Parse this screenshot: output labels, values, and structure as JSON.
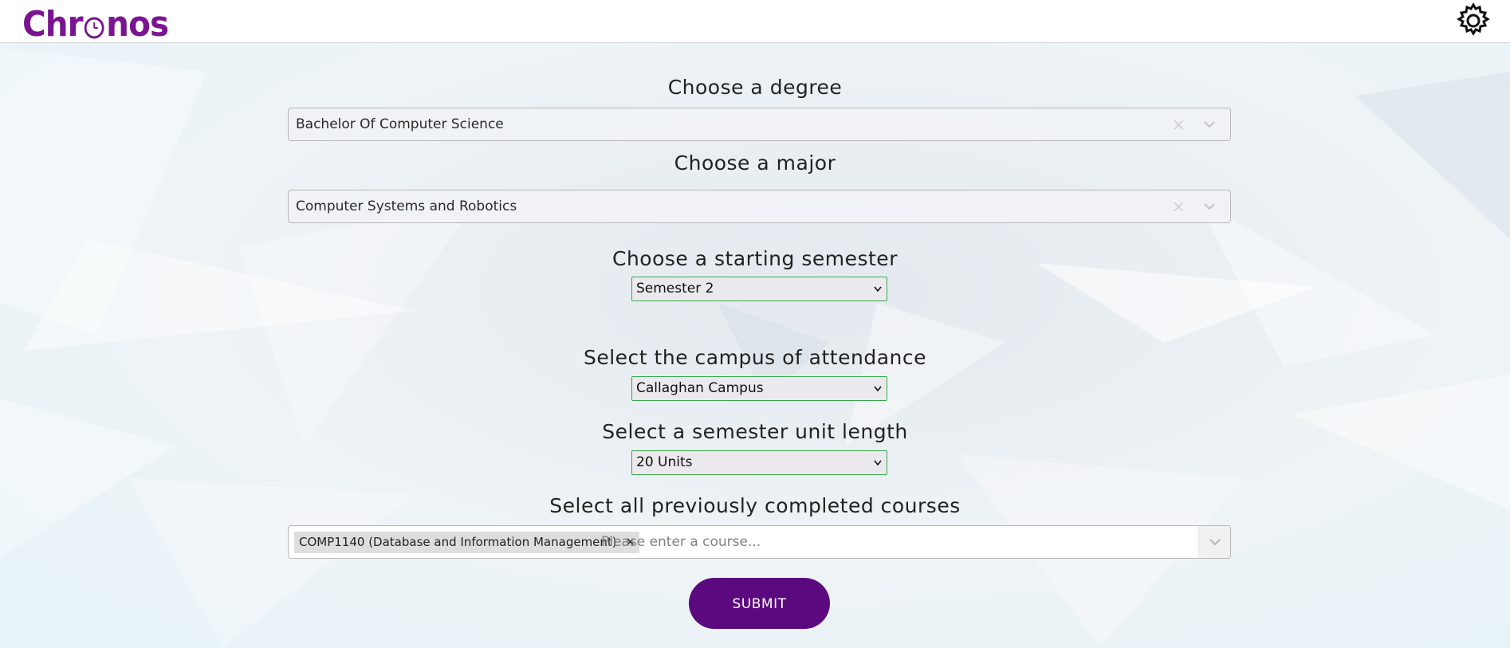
{
  "app": {
    "logo_text_left": "Chr",
    "logo_text_right": "nos",
    "brand_color": "#7b1490",
    "accent_color": "#5a0a7e",
    "settings_icon": "gear-icon"
  },
  "form": {
    "degree": {
      "label": "Choose a degree",
      "value": "Bachelor Of Computer Science",
      "clear_icon": "×"
    },
    "major": {
      "label": "Choose a major",
      "value": "Computer Systems and Robotics",
      "clear_icon": "×"
    },
    "semester": {
      "label": "Choose a starting semester",
      "value": "Semester 2"
    },
    "campus": {
      "label": "Select the campus of attendance",
      "value": "Callaghan Campus"
    },
    "unit_length": {
      "label": "Select a semester unit length",
      "value": "20 Units"
    },
    "completed_courses": {
      "label": "Select all previously completed courses",
      "selected": [
        "COMP1140 (Database and Information Management)"
      ],
      "remove_icon": "×",
      "placeholder": "Please enter a course..."
    },
    "submit_label": "SUBMIT"
  }
}
